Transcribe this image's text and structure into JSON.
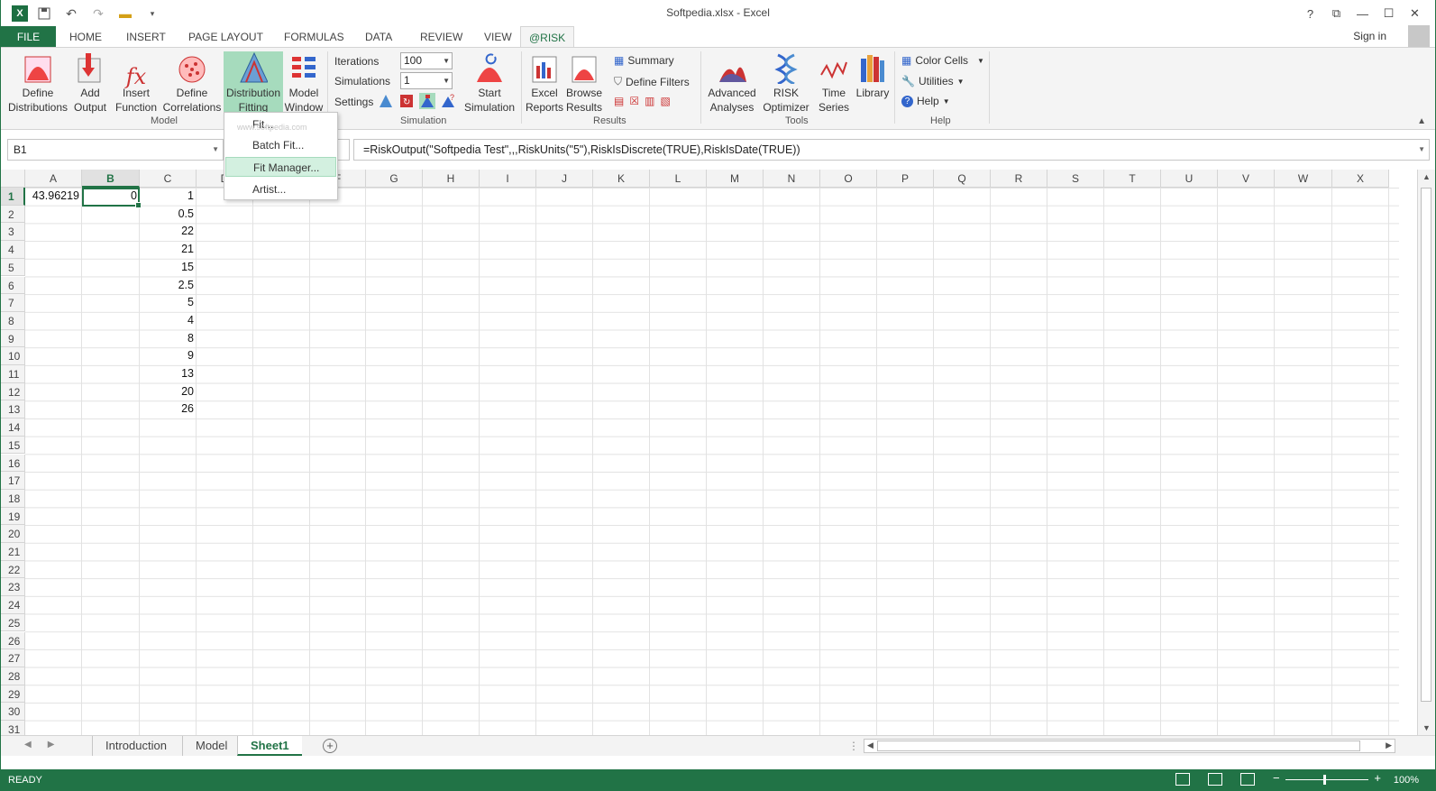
{
  "window": {
    "title": "Softpedia.xlsx - Excel",
    "logo_letter": "X",
    "controls": [
      "?",
      "⧉",
      "—",
      "☐",
      "✕"
    ]
  },
  "tabs": [
    {
      "label": "FILE"
    },
    {
      "label": "HOME"
    },
    {
      "label": "INSERT"
    },
    {
      "label": "PAGE LAYOUT"
    },
    {
      "label": "FORMULAS"
    },
    {
      "label": "DATA"
    },
    {
      "label": "REVIEW"
    },
    {
      "label": "VIEW"
    },
    {
      "label": "@RISK"
    }
  ],
  "sign_in": "Sign in",
  "ribbon": {
    "model": {
      "label": "Model",
      "define_distributions": "Define\nDistributions",
      "add_output": "Add\nOutput",
      "insert_function": "Insert\nFunction",
      "define_correlations": "Define\nCorrelations",
      "distribution_fitting": "Distribution\nFitting",
      "model_window": "Model\nWindow"
    },
    "simulation": {
      "label": "Simulation",
      "iterations_label": "Iterations",
      "iterations_value": "100",
      "simulations_label": "Simulations",
      "simulations_value": "1",
      "settings_label": "Settings",
      "start_simulation": "Start\nSimulation"
    },
    "results": {
      "label": "Results",
      "excel_reports": "Excel\nReports",
      "browse_results": "Browse\nResults",
      "summary": "Summary",
      "define_filters": "Define Filters"
    },
    "tools": {
      "label": "Tools",
      "advanced_analyses": "Advanced\nAnalyses",
      "risk_optimizer": "RISK\nOptimizer",
      "time_series": "Time\nSeries",
      "library": "Library"
    },
    "help": {
      "label": "Help",
      "color_cells": "Color Cells",
      "utilities": "Utilities",
      "help": "Help"
    }
  },
  "dropdown": {
    "items": [
      "Fit...",
      "Batch Fit...",
      "Fit Manager...",
      "Artist..."
    ],
    "watermark": "www.softpedia.com"
  },
  "formula_bar": {
    "name_box": "B1",
    "formula": "=RiskOutput(\"Softpedia Test\",,,RiskUnits(\"5\"),RiskIsDiscrete(TRUE),RiskIsDate(TRUE))"
  },
  "columns": [
    "A",
    "B",
    "C",
    "D",
    "E",
    "F",
    "G",
    "H",
    "I",
    "J",
    "K",
    "L",
    "M",
    "N",
    "O",
    "P",
    "Q",
    "R",
    "S",
    "T",
    "U",
    "V",
    "W",
    "X"
  ],
  "rows": [
    "1",
    "2",
    "3",
    "4",
    "5",
    "6",
    "7",
    "8",
    "9",
    "10",
    "11",
    "12",
    "13",
    "14",
    "15",
    "16",
    "17",
    "18",
    "19",
    "20",
    "21",
    "22",
    "23",
    "24",
    "25",
    "26",
    "27",
    "28",
    "29",
    "30",
    "31"
  ],
  "cells": {
    "A1": "43.96219",
    "B1": "0",
    "C": [
      "1",
      "0.5",
      "22",
      "21",
      "15",
      "2.5",
      "5",
      "4",
      "8",
      "9",
      "13",
      "20",
      "26"
    ]
  },
  "sheets": [
    "Introduction",
    "Model",
    "Sheet1"
  ],
  "status": {
    "ready": "READY",
    "zoom": "100%"
  },
  "colors": {
    "excel_green": "#217346",
    "selected_button": "#a6dbbd"
  }
}
